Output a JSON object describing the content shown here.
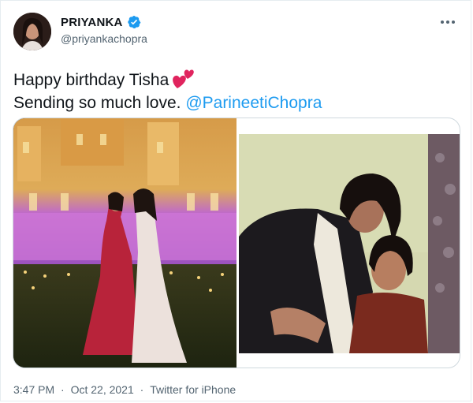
{
  "author": {
    "display_name": "PRIYANKA",
    "handle": "@priyankachopra",
    "avatar_icon": "profile-photo",
    "verified_icon": "verified-badge-icon",
    "verified_color": "#1d9bf0"
  },
  "tweet": {
    "line1": "Happy birthday Tisha",
    "line1_emoji_icon": "two-hearts-icon",
    "line2_text": "Sending so much love.",
    "mention": "@ParineetiChopra"
  },
  "media": {
    "photo1": "two women in gowns before illuminated palace at night",
    "photo2": "vintage photo of a woman hugging a young girl"
  },
  "footer": {
    "time": "3:47 PM",
    "date": "Oct 22, 2021",
    "separator": "·",
    "source": "Twitter for iPhone"
  },
  "colors": {
    "text": "#0f1419",
    "secondary": "#536471",
    "link": "#1d9bf0",
    "border": "#cfd9de"
  }
}
